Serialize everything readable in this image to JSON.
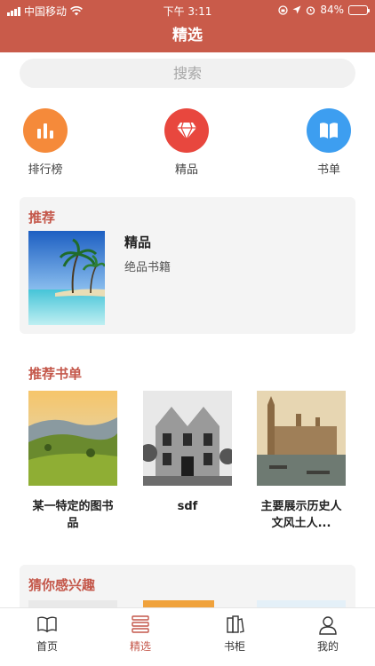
{
  "status_bar": {
    "carrier": "中国移动",
    "time": "下午 3:11",
    "battery": "84%",
    "battery_level": 0.84,
    "icons": [
      "signal-icon",
      "wifi-icon",
      "lock-rotation-icon",
      "location-icon",
      "alarm-icon",
      "battery-icon"
    ]
  },
  "nav": {
    "title": "精选"
  },
  "search": {
    "placeholder": "搜索"
  },
  "quick_entries": [
    {
      "label": "排行榜",
      "icon": "bar-chart-icon",
      "color": "#f58a3a"
    },
    {
      "label": "精品",
      "icon": "diamond-icon",
      "color": "#e8473e"
    },
    {
      "label": "书单",
      "icon": "book-icon",
      "color": "#3d9ef0"
    }
  ],
  "recommend": {
    "section_title": "推荐",
    "title": "精品",
    "description": "绝品书籍",
    "cover": "beach-palm-trees-image"
  },
  "book_lists": {
    "section_title": "推荐书单",
    "items": [
      {
        "title": "某一特定的图书品",
        "cover": "hills-landscape-image"
      },
      {
        "title": "sdf",
        "cover": "mansion-photo-image"
      },
      {
        "title": "主要展示历史人文风土人...",
        "cover": "parliament-painting-image"
      }
    ]
  },
  "interest": {
    "section_title": "猜你感兴趣"
  },
  "tabs": [
    {
      "label": "首页",
      "icon": "open-book-icon",
      "active": false
    },
    {
      "label": "精选",
      "icon": "stack-icon",
      "active": true
    },
    {
      "label": "书柜",
      "icon": "bookshelf-icon",
      "active": false
    },
    {
      "label": "我的",
      "icon": "person-icon",
      "active": false
    }
  ],
  "colors": {
    "brand": "#c95b4a",
    "accent_text": "#c4574a",
    "card_bg": "#f4f4f4"
  }
}
